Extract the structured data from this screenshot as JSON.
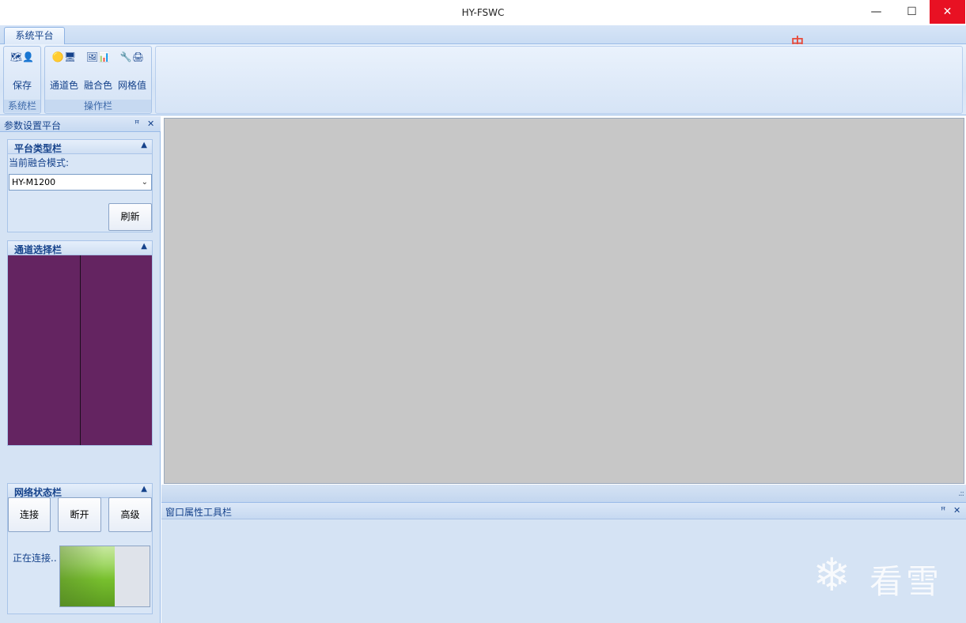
{
  "window": {
    "title": "HY-FSWC",
    "min_icon": "minimize-icon",
    "max_icon": "maximize-icon",
    "close_icon": "close-icon"
  },
  "ribbon": {
    "tab": "系统平台",
    "ime_indicator": "中",
    "groups": [
      {
        "label": "系统栏",
        "buttons": [
          {
            "label": "保存",
            "icon": "save-icon"
          }
        ]
      },
      {
        "label": "操作栏",
        "buttons": [
          {
            "label": "通道色",
            "icon": "channel-color-icon"
          },
          {
            "label": "融合色",
            "icon": "blend-color-icon"
          },
          {
            "label": "网格值",
            "icon": "grid-value-icon"
          }
        ]
      }
    ]
  },
  "left_panel": {
    "title": "参数设置平台",
    "platform_section": {
      "title": "平台类型栏",
      "mode_label": "当前融合模式:",
      "mode_value": "HY-M1200",
      "refresh_label": "刷新"
    },
    "channel_section": {
      "title": "通道选择栏",
      "channel_color": "#642461"
    },
    "network_section": {
      "title": "网络状态栏",
      "connect_label": "连接",
      "disconnect_label": "断开",
      "advanced_label": "高级",
      "status_text": "正在连接.."
    }
  },
  "bottom_panel": {
    "title": "窗口属性工具栏"
  },
  "watermark": {
    "text": "看雪",
    "icon": "snowflake-icon"
  }
}
